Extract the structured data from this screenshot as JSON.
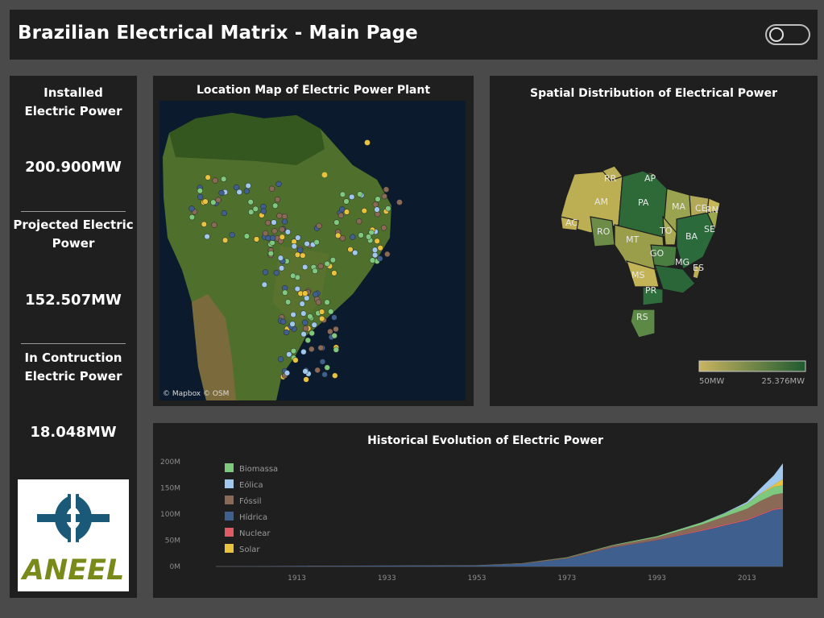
{
  "header": {
    "title": "Brazilian Electrical Matrix - Main Page"
  },
  "kpis": [
    {
      "label_line1": "Installed",
      "label_line2": "Electric Power",
      "value": "200.900MW"
    },
    {
      "label_line1": "Projected Electric",
      "label_line2": "Power",
      "value": "152.507MW"
    },
    {
      "label_line1": "In Contruction",
      "label_line2": "Electric Power",
      "value": "18.048MW"
    }
  ],
  "logo": {
    "text": "ANEEL"
  },
  "location_map": {
    "title": "Location Map of Electric Power Plant",
    "attribution": "© Mapbox  © OSM"
  },
  "spatial_map": {
    "title": "Spatial Distribution of Electrical Power",
    "legend_min": "50MW",
    "legend_max": "25.376MW",
    "color_low": "#c9b460",
    "color_high": "#1e5a30",
    "states": [
      "RR",
      "AP",
      "AM",
      "PA",
      "MA",
      "CE",
      "RN",
      "AC",
      "RO",
      "MT",
      "TO",
      "BA",
      "SE",
      "GO",
      "MG",
      "ES",
      "MS",
      "PR",
      "RS"
    ]
  },
  "historical": {
    "title": "Historical Evolution of Electric Power",
    "legend": [
      {
        "name": "Biomassa",
        "color": "#7ec97e"
      },
      {
        "name": "Eólica",
        "color": "#9fc8ec"
      },
      {
        "name": "Fóssil",
        "color": "#8a6a56"
      },
      {
        "name": "Hídrica",
        "color": "#3f5f8e"
      },
      {
        "name": "Nuclear",
        "color": "#e05c64"
      },
      {
        "name": "Solar",
        "color": "#e9c23e"
      }
    ]
  },
  "chart_data": {
    "type": "area",
    "title": "Historical Evolution of Electric Power",
    "x": [
      1895,
      1913,
      1933,
      1953,
      1963,
      1973,
      1983,
      1993,
      2003,
      2008,
      2013,
      2016,
      2019,
      2021
    ],
    "x_tick_labels": [
      "1913",
      "1933",
      "1953",
      "1973",
      "1993",
      "2013"
    ],
    "y_tick_labels": [
      "200M",
      "150M",
      "100M",
      "50M",
      "0M"
    ],
    "ylim": [
      0,
      200
    ],
    "series": [
      {
        "name": "Hídrica",
        "values": [
          0,
          1,
          1.5,
          2,
          5,
          15,
          36,
          50,
          68,
          78,
          88,
          98,
          108,
          110
        ]
      },
      {
        "name": "Nuclear",
        "values": [
          0,
          0,
          0,
          0,
          0,
          0,
          0.6,
          0.6,
          2,
          2,
          2,
          2,
          2,
          2
        ]
      },
      {
        "name": "Fóssil",
        "values": [
          0,
          0.2,
          0.3,
          0.5,
          1,
          2,
          3,
          5,
          10,
          15,
          20,
          25,
          27,
          28
        ]
      },
      {
        "name": "Biomassa",
        "values": [
          0,
          0,
          0,
          0,
          0.2,
          0.5,
          1,
          2,
          4,
          6,
          10,
          13,
          15,
          15
        ]
      },
      {
        "name": "Solar",
        "values": [
          0,
          0,
          0,
          0,
          0,
          0,
          0,
          0,
          0,
          0,
          0,
          1,
          4,
          12
        ]
      },
      {
        "name": "Eólica",
        "values": [
          0,
          0,
          0,
          0,
          0,
          0,
          0,
          0,
          0.5,
          1,
          3,
          10,
          18,
          30
        ]
      }
    ]
  }
}
